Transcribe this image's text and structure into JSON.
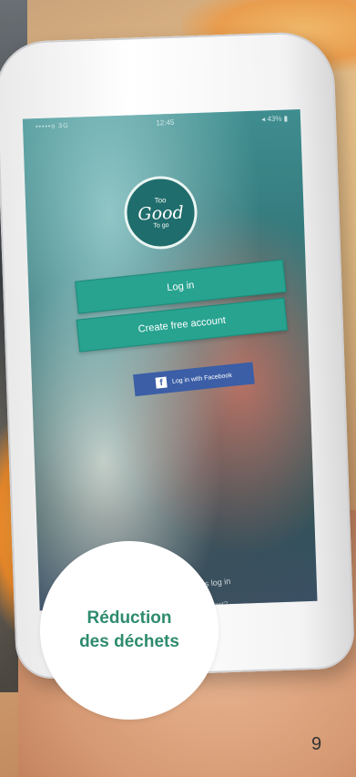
{
  "status_bar": {
    "signal": "•••••o 3G",
    "time": "12:45",
    "battery": "◂ 43% ▮"
  },
  "logo": {
    "top": "Too",
    "middle": "Good",
    "bottom": "To go"
  },
  "buttons": {
    "login": "Log in",
    "create": "Create free account",
    "facebook": "Log in with Facebook"
  },
  "footer": {
    "business_login": "Business log in",
    "sub": "forgot?"
  },
  "badge": {
    "line1": "Réduction",
    "line2": "des déchets"
  },
  "page_number": "9",
  "colors": {
    "accent": "#27a390",
    "badge_text": "#2e8b6e",
    "facebook": "#3b5ea6"
  }
}
